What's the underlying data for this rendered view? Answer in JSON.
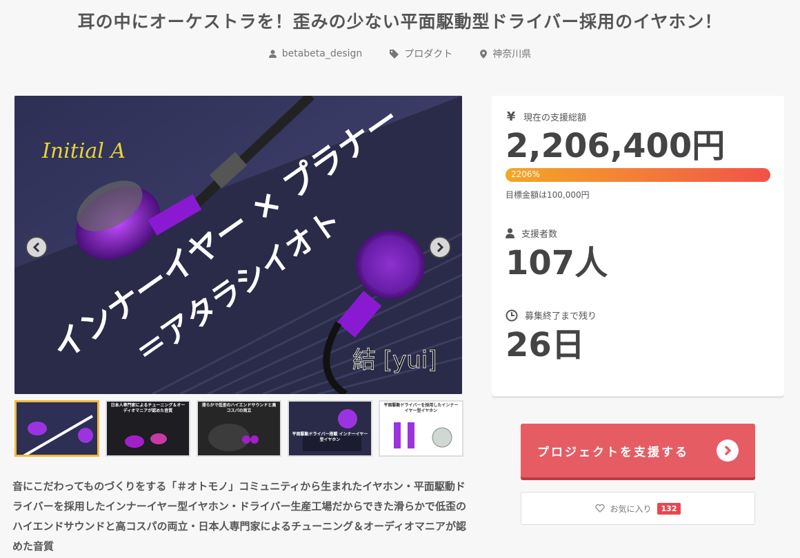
{
  "page": {
    "title": "耳の中にオーケストラを！歪みの少ない平面駆動型ドライバー採用のイヤホン！"
  },
  "meta": {
    "author": "betabeta_design",
    "category": "プロダクト",
    "location": "神奈川県"
  },
  "gallery": {
    "main_image": {
      "overlay_main": "インナーイヤー × プラナー",
      "overlay_sub": "＝アタラシイオト",
      "signature": "Initial A",
      "brand": "結 [yui]"
    },
    "thumbnails": [
      {
        "label": "",
        "active": true
      },
      {
        "label": "日本人専門家によるチューニング＆オーディオマニアが認めた音質",
        "active": false
      },
      {
        "label": "滑らかで低歪のハイエンドサウンドと高コスパの両立",
        "active": false
      },
      {
        "label": "平面駆動ドライバー搭載 インナーイヤー型イヤホン",
        "active": false
      },
      {
        "label": "平面駆動ドライバーを採用したインナーイヤー型イヤホン",
        "active": false
      }
    ]
  },
  "description": "音にこだわってものづくりをする「＃オトモノ」コミュニティから生まれたイヤホン・平面駆動ドライバーを採用したインナーイヤー型イヤホン・ドライバー生産工場だからできた滑らかで低歪のハイエンドサウンドと高コスパの両立・日本人専門家によるチューニング＆オーディオマニアが認めた音質",
  "stats": {
    "total_label": "現在の支援総額",
    "total_value": "2,206,400円",
    "progress_text": "2206%",
    "progress_fraction": 1.0,
    "goal_text": "目標金額は100,000円",
    "backers_label": "支援者数",
    "backers_value": "107人",
    "remaining_label": "募集終了まで残り",
    "remaining_value": "26日"
  },
  "actions": {
    "support_label": "プロジェクトを支援する",
    "favorite_label": "お気に入り",
    "favorite_count": "132"
  },
  "colors": {
    "accent": "#e65c63",
    "progress_start": "#f5a623",
    "progress_end": "#f25248",
    "thumb_active": "#f0b93a"
  },
  "icons": {
    "author": "user-icon",
    "category": "tag-icon",
    "location": "map-pin-icon",
    "total": "yen-icon",
    "backers": "user-icon",
    "remaining": "clock-icon",
    "favorite": "heart-icon"
  }
}
